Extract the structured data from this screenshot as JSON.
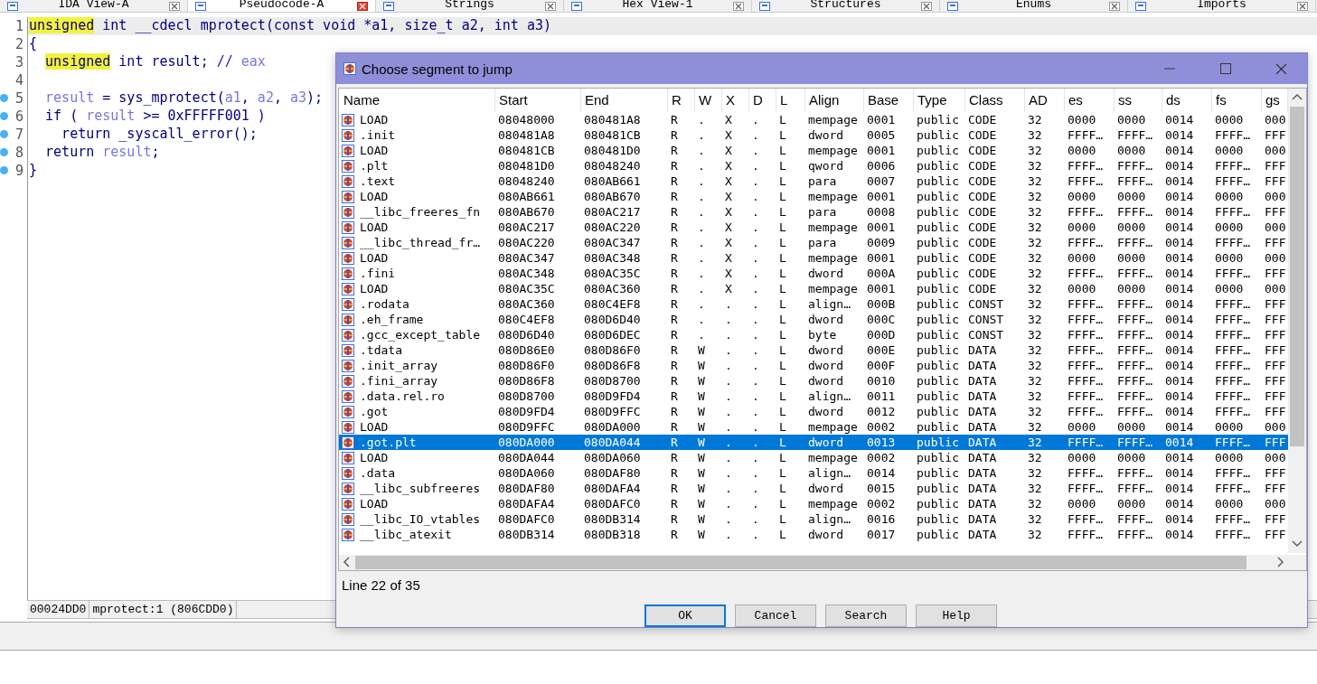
{
  "tabs": [
    {
      "label": "IDA View-A",
      "selected": false
    },
    {
      "label": "Pseudocode-A",
      "selected": true
    },
    {
      "label": "Strings",
      "selected": false
    },
    {
      "label": "Hex View-1",
      "selected": false
    },
    {
      "label": "Structures",
      "selected": false
    },
    {
      "label": "Enums",
      "selected": false
    },
    {
      "label": "Imports",
      "selected": false
    }
  ],
  "code": {
    "lines": [
      {
        "number": "1",
        "current": true,
        "breakpoint": false,
        "tokens": [
          {
            "text": "unsigned",
            "kind": "highlight"
          },
          {
            "text": " int __cdecl mprotect(const void *a1, size_t a2, int a3)",
            "kind": "code"
          }
        ]
      },
      {
        "number": "2",
        "current": false,
        "breakpoint": false,
        "tokens": [
          {
            "text": "{",
            "kind": "code"
          }
        ],
        "children": [
          {
            "number": "3",
            "current": false,
            "breakpoint": false,
            "tokens": [
              {
                "text": "unsigned",
                "kind": "highlight"
              },
              {
                "text": " int result; ",
                "kind": "code"
              },
              {
                "text": "// ",
                "kind": "comment"
              },
              {
                "text": "eax",
                "kind": "var"
              }
            ]
          },
          {
            "number": "4",
            "current": false,
            "breakpoint": false
          },
          {
            "number": "5",
            "current": false,
            "breakpoint": true,
            "tokens": [
              {
                "text": "result",
                "kind": "var"
              },
              {
                "text": " = sys_mprotect(",
                "kind": "code"
              },
              {
                "text": "a1",
                "kind": "var"
              },
              {
                "text": ", ",
                "kind": "code"
              },
              {
                "text": "a2",
                "kind": "var"
              },
              {
                "text": ", ",
                "kind": "code"
              },
              {
                "text": "a3",
                "kind": "var"
              },
              {
                "text": ");",
                "kind": "code"
              }
            ]
          },
          {
            "number": "6",
            "current": false,
            "breakpoint": true,
            "tokens": [
              {
                "text": "if ( ",
                "kind": "code"
              },
              {
                "text": "result",
                "kind": "var"
              },
              {
                "text": " >= 0xFFFFF001 )",
                "kind": "code"
              }
            ],
            "children": [
              {
                "number": "7",
                "current": false,
                "breakpoint": true,
                "tokens": [
                  {
                    "text": "return _syscall_error();",
                    "kind": "code"
                  }
                ]
              }
            ]
          },
          {
            "number": "8",
            "current": false,
            "breakpoint": true,
            "tokens": [
              {
                "text": "return ",
                "kind": "code"
              },
              {
                "text": "result",
                "kind": "var"
              },
              {
                "text": ";",
                "kind": "code"
              }
            ]
          }
        ]
      },
      {
        "number": "9",
        "current": false,
        "breakpoint": true,
        "tokens": [
          {
            "text": "}",
            "kind": "code"
          }
        ]
      }
    ],
    "status": [
      "00024DD0",
      "mprotect:1 (806CDD0)"
    ]
  },
  "dialog": {
    "title": "Choose segment to jump",
    "columns": [
      "Name",
      "Start",
      "End",
      "R",
      "W",
      "X",
      "D",
      "L",
      "Align",
      "Base",
      "Type",
      "Class",
      "AD",
      "es",
      "ss",
      "ds",
      "fs",
      "gs"
    ],
    "rows": [
      {
        "selected": false,
        "cells": [
          "LOAD",
          "08048000",
          "080481A8",
          "R",
          ".",
          "X",
          ".",
          "L",
          "mempage",
          "0001",
          "public",
          "CODE",
          "32",
          "0000",
          "0000",
          "0014",
          "0000",
          "000"
        ]
      },
      {
        "selected": false,
        "cells": [
          ".init",
          "080481A8",
          "080481CB",
          "R",
          ".",
          "X",
          ".",
          "L",
          "dword",
          "0005",
          "public",
          "CODE",
          "32",
          "FFFF…",
          "FFFF…",
          "0014",
          "FFFF…",
          "FFF"
        ]
      },
      {
        "selected": false,
        "cells": [
          "LOAD",
          "080481CB",
          "080481D0",
          "R",
          ".",
          "X",
          ".",
          "L",
          "mempage",
          "0001",
          "public",
          "CODE",
          "32",
          "0000",
          "0000",
          "0014",
          "0000",
          "000"
        ]
      },
      {
        "selected": false,
        "cells": [
          ".plt",
          "080481D0",
          "08048240",
          "R",
          ".",
          "X",
          ".",
          "L",
          "qword",
          "0006",
          "public",
          "CODE",
          "32",
          "FFFF…",
          "FFFF…",
          "0014",
          "FFFF…",
          "FFF"
        ]
      },
      {
        "selected": false,
        "cells": [
          ".text",
          "08048240",
          "080AB661",
          "R",
          ".",
          "X",
          ".",
          "L",
          "para",
          "0007",
          "public",
          "CODE",
          "32",
          "FFFF…",
          "FFFF…",
          "0014",
          "FFFF…",
          "FFF"
        ]
      },
      {
        "selected": false,
        "cells": [
          "LOAD",
          "080AB661",
          "080AB670",
          "R",
          ".",
          "X",
          ".",
          "L",
          "mempage",
          "0001",
          "public",
          "CODE",
          "32",
          "0000",
          "0000",
          "0014",
          "0000",
          "000"
        ]
      },
      {
        "selected": false,
        "cells": [
          "__libc_freeres_fn",
          "080AB670",
          "080AC217",
          "R",
          ".",
          "X",
          ".",
          "L",
          "para",
          "0008",
          "public",
          "CODE",
          "32",
          "FFFF…",
          "FFFF…",
          "0014",
          "FFFF…",
          "FFF"
        ]
      },
      {
        "selected": false,
        "cells": [
          "LOAD",
          "080AC217",
          "080AC220",
          "R",
          ".",
          "X",
          ".",
          "L",
          "mempage",
          "0001",
          "public",
          "CODE",
          "32",
          "0000",
          "0000",
          "0014",
          "0000",
          "000"
        ]
      },
      {
        "selected": false,
        "cells": [
          "__libc_thread_fr…",
          "080AC220",
          "080AC347",
          "R",
          ".",
          "X",
          ".",
          "L",
          "para",
          "0009",
          "public",
          "CODE",
          "32",
          "FFFF…",
          "FFFF…",
          "0014",
          "FFFF…",
          "FFF"
        ]
      },
      {
        "selected": false,
        "cells": [
          "LOAD",
          "080AC347",
          "080AC348",
          "R",
          ".",
          "X",
          ".",
          "L",
          "mempage",
          "0001",
          "public",
          "CODE",
          "32",
          "0000",
          "0000",
          "0014",
          "0000",
          "000"
        ]
      },
      {
        "selected": false,
        "cells": [
          ".fini",
          "080AC348",
          "080AC35C",
          "R",
          ".",
          "X",
          ".",
          "L",
          "dword",
          "000A",
          "public",
          "CODE",
          "32",
          "FFFF…",
          "FFFF…",
          "0014",
          "FFFF…",
          "FFF"
        ]
      },
      {
        "selected": false,
        "cells": [
          "LOAD",
          "080AC35C",
          "080AC360",
          "R",
          ".",
          "X",
          ".",
          "L",
          "mempage",
          "0001",
          "public",
          "CODE",
          "32",
          "0000",
          "0000",
          "0014",
          "0000",
          "000"
        ]
      },
      {
        "selected": false,
        "cells": [
          ".rodata",
          "080AC360",
          "080C4EF8",
          "R",
          ".",
          ".",
          ".",
          "L",
          "align…",
          "000B",
          "public",
          "CONST",
          "32",
          "FFFF…",
          "FFFF…",
          "0014",
          "FFFF…",
          "FFF"
        ]
      },
      {
        "selected": false,
        "cells": [
          ".eh_frame",
          "080C4EF8",
          "080D6D40",
          "R",
          ".",
          ".",
          ".",
          "L",
          "dword",
          "000C",
          "public",
          "CONST",
          "32",
          "FFFF…",
          "FFFF…",
          "0014",
          "FFFF…",
          "FFF"
        ]
      },
      {
        "selected": false,
        "cells": [
          ".gcc_except_table",
          "080D6D40",
          "080D6DEC",
          "R",
          ".",
          ".",
          ".",
          "L",
          "byte",
          "000D",
          "public",
          "CONST",
          "32",
          "FFFF…",
          "FFFF…",
          "0014",
          "FFFF…",
          "FFF"
        ]
      },
      {
        "selected": false,
        "cells": [
          ".tdata",
          "080D86E0",
          "080D86F0",
          "R",
          "W",
          ".",
          ".",
          "L",
          "dword",
          "000E",
          "public",
          "DATA",
          "32",
          "FFFF…",
          "FFFF…",
          "0014",
          "FFFF…",
          "FFF"
        ]
      },
      {
        "selected": false,
        "cells": [
          ".init_array",
          "080D86F0",
          "080D86F8",
          "R",
          "W",
          ".",
          ".",
          "L",
          "dword",
          "000F",
          "public",
          "DATA",
          "32",
          "FFFF…",
          "FFFF…",
          "0014",
          "FFFF…",
          "FFF"
        ]
      },
      {
        "selected": false,
        "cells": [
          ".fini_array",
          "080D86F8",
          "080D8700",
          "R",
          "W",
          ".",
          ".",
          "L",
          "dword",
          "0010",
          "public",
          "DATA",
          "32",
          "FFFF…",
          "FFFF…",
          "0014",
          "FFFF…",
          "FFF"
        ]
      },
      {
        "selected": false,
        "cells": [
          ".data.rel.ro",
          "080D8700",
          "080D9FD4",
          "R",
          "W",
          ".",
          ".",
          "L",
          "align…",
          "0011",
          "public",
          "DATA",
          "32",
          "FFFF…",
          "FFFF…",
          "0014",
          "FFFF…",
          "FFF"
        ]
      },
      {
        "selected": false,
        "cells": [
          ".got",
          "080D9FD4",
          "080D9FFC",
          "R",
          "W",
          ".",
          ".",
          "L",
          "dword",
          "0012",
          "public",
          "DATA",
          "32",
          "FFFF…",
          "FFFF…",
          "0014",
          "FFFF…",
          "FFF"
        ]
      },
      {
        "selected": false,
        "cells": [
          "LOAD",
          "080D9FFC",
          "080DA000",
          "R",
          "W",
          ".",
          ".",
          "L",
          "mempage",
          "0002",
          "public",
          "DATA",
          "32",
          "0000",
          "0000",
          "0014",
          "0000",
          "000"
        ]
      },
      {
        "selected": true,
        "cells": [
          ".got.plt",
          "080DA000",
          "080DA044",
          "R",
          "W",
          ".",
          ".",
          "L",
          "dword",
          "0013",
          "public",
          "DATA",
          "32",
          "FFFF…",
          "FFFF…",
          "0014",
          "FFFF…",
          "FFF"
        ]
      },
      {
        "selected": false,
        "cells": [
          "LOAD",
          "080DA044",
          "080DA060",
          "R",
          "W",
          ".",
          ".",
          "L",
          "mempage",
          "0002",
          "public",
          "DATA",
          "32",
          "0000",
          "0000",
          "0014",
          "0000",
          "000"
        ]
      },
      {
        "selected": false,
        "cells": [
          ".data",
          "080DA060",
          "080DAF80",
          "R",
          "W",
          ".",
          ".",
          "L",
          "align…",
          "0014",
          "public",
          "DATA",
          "32",
          "FFFF…",
          "FFFF…",
          "0014",
          "FFFF…",
          "FFF"
        ]
      },
      {
        "selected": false,
        "cells": [
          "__libc_subfreeres",
          "080DAF80",
          "080DAFA4",
          "R",
          "W",
          ".",
          ".",
          "L",
          "dword",
          "0015",
          "public",
          "DATA",
          "32",
          "FFFF…",
          "FFFF…",
          "0014",
          "FFFF…",
          "FFF"
        ]
      },
      {
        "selected": false,
        "cells": [
          "LOAD",
          "080DAFA4",
          "080DAFC0",
          "R",
          "W",
          ".",
          ".",
          "L",
          "mempage",
          "0002",
          "public",
          "DATA",
          "32",
          "0000",
          "0000",
          "0014",
          "0000",
          "000"
        ]
      },
      {
        "selected": false,
        "cells": [
          "__libc_IO_vtables",
          "080DAFC0",
          "080DB314",
          "R",
          "W",
          ".",
          ".",
          "L",
          "align…",
          "0016",
          "public",
          "DATA",
          "32",
          "FFFF…",
          "FFFF…",
          "0014",
          "FFFF…",
          "FFF"
        ]
      },
      {
        "selected": false,
        "cells": [
          "__libc_atexit",
          "080DB314",
          "080DB318",
          "R",
          "W",
          ".",
          ".",
          "L",
          "dword",
          "0017",
          "public",
          "DATA",
          "32",
          "FFFF…",
          "FFFF…",
          "0014",
          "FFFF…",
          "FFF"
        ]
      }
    ],
    "status": "Line 22 of 35",
    "buttons": [
      {
        "label": "OK",
        "default": true
      },
      {
        "label": "Cancel",
        "default": false
      },
      {
        "label": "Search",
        "default": false
      },
      {
        "label": "Help",
        "default": false
      }
    ]
  }
}
